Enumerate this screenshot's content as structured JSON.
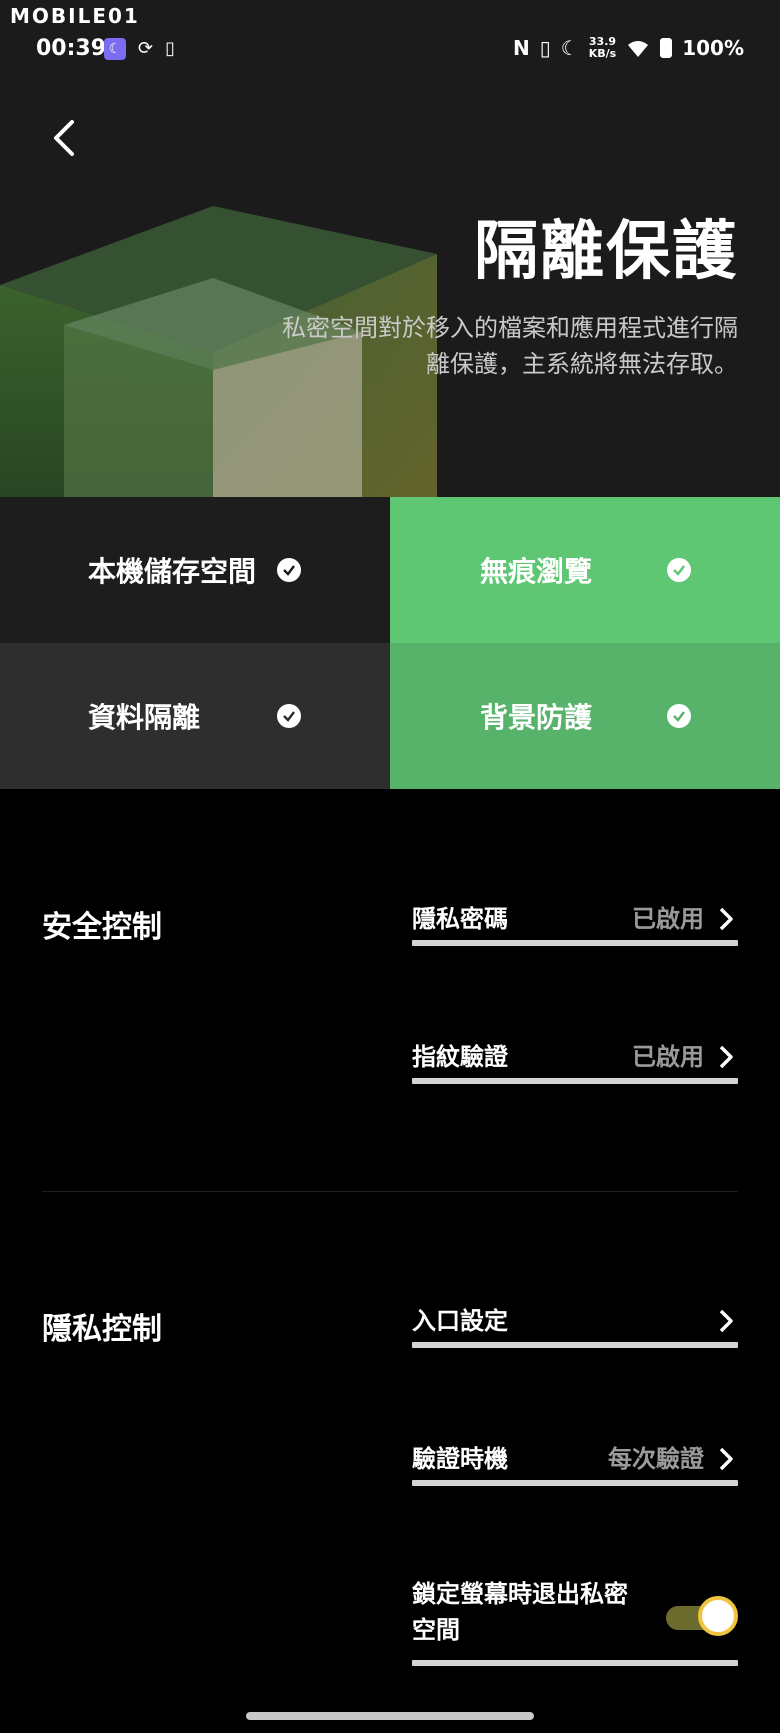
{
  "status_bar": {
    "watermark": "MOBILE01",
    "time": "00:39",
    "speed_value": "33.9",
    "speed_unit": "KB/s",
    "battery": "100%"
  },
  "hero": {
    "title": "隔離保護",
    "subtitle": "私密空間對於移入的檔案和應用程式進行隔離保護，主系統將無法存取。"
  },
  "features": [
    {
      "label": "本機儲存空間",
      "color": "#1d1d1d"
    },
    {
      "label": "無痕瀏覽",
      "color": "#5fc674"
    },
    {
      "label": "資料隔離",
      "color": "#2e2e2e"
    },
    {
      "label": "背景防護",
      "color": "#57b26a"
    }
  ],
  "security": {
    "title": "安全控制",
    "rows": [
      {
        "label": "隱私密碼",
        "value": "已啟用"
      },
      {
        "label": "指紋驗證",
        "value": "已啟用"
      }
    ]
  },
  "privacy": {
    "title": "隱私控制",
    "rows": [
      {
        "label": "入口設定",
        "value": ""
      },
      {
        "label": "驗證時機",
        "value": "每次驗證"
      }
    ],
    "toggle_row": {
      "label": "鎖定螢幕時退出私密空間",
      "state": "on"
    }
  }
}
